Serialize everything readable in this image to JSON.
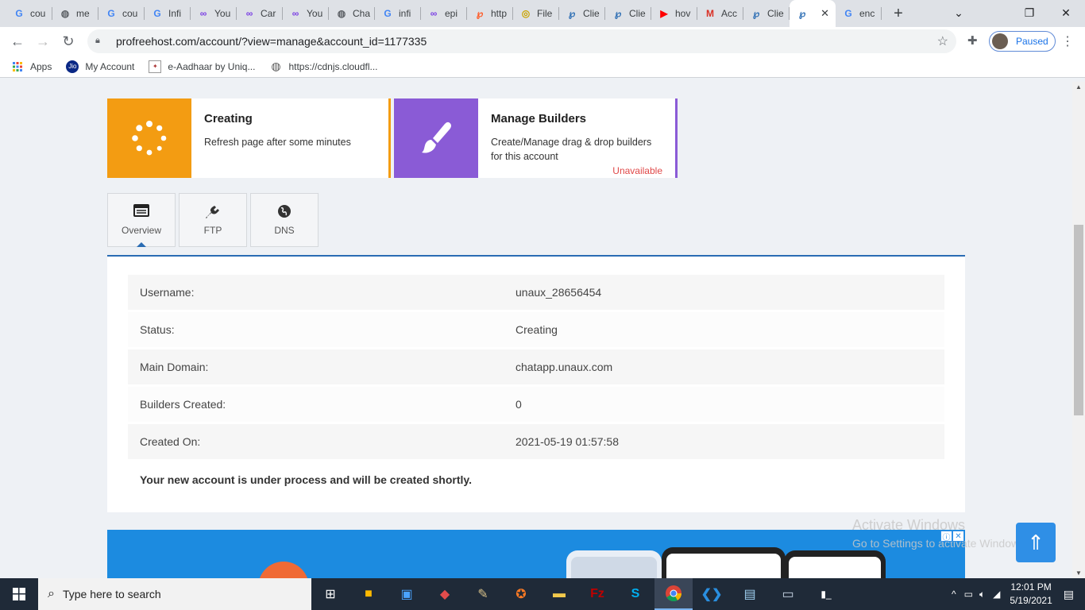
{
  "browser": {
    "tabs": [
      {
        "icon": "G",
        "title": "cou",
        "color": "#4285f4"
      },
      {
        "icon": "◍",
        "title": "me",
        "color": "#5f6368"
      },
      {
        "icon": "G",
        "title": "cou",
        "color": "#4285f4"
      },
      {
        "icon": "G",
        "title": "Infi",
        "color": "#4285f4"
      },
      {
        "icon": "∞",
        "title": "You",
        "color": "#7b3fe4"
      },
      {
        "icon": "∞",
        "title": "Car",
        "color": "#7b3fe4"
      },
      {
        "icon": "∞",
        "title": "You",
        "color": "#7b3fe4"
      },
      {
        "icon": "◍",
        "title": "Cha",
        "color": "#5f6368"
      },
      {
        "icon": "G",
        "title": "infi",
        "color": "#4285f4"
      },
      {
        "icon": "∞",
        "title": "epi",
        "color": "#7b3fe4"
      },
      {
        "icon": "℘",
        "title": "http",
        "color": "#ff5722"
      },
      {
        "icon": "◎",
        "title": "File",
        "color": "#c9a400"
      },
      {
        "icon": "℘",
        "title": "Clie",
        "color": "#2a6cb3"
      },
      {
        "icon": "℘",
        "title": "Clie",
        "color": "#2a6cb3"
      },
      {
        "icon": "▶",
        "title": "hov",
        "color": "#ff0000"
      },
      {
        "icon": "M",
        "title": "Acc",
        "color": "#d93025"
      },
      {
        "icon": "℘",
        "title": "Clie",
        "color": "#2a6cb3"
      },
      {
        "icon": "℘",
        "title": "",
        "color": "#2a6cb3",
        "active": true
      },
      {
        "icon": "G",
        "title": "enc",
        "color": "#4285f4"
      }
    ],
    "url": "profreehost.com/account/?view=manage&account_id=1177335",
    "profile_status": "Paused",
    "bookmarks": [
      {
        "label": "Apps",
        "icon": "apps-grid-icon"
      },
      {
        "label": "My Account",
        "icon": "jio-icon"
      },
      {
        "label": "e-Aadhaar by Uniq...",
        "icon": "aadhaar-icon"
      },
      {
        "label": "https://cdnjs.cloudfl...",
        "icon": "globe-icon"
      }
    ]
  },
  "cards": {
    "creating": {
      "title": "Creating",
      "desc": "Refresh page after some minutes",
      "accent": "#f39c12"
    },
    "builders": {
      "title": "Manage Builders",
      "desc": "Create/Manage drag & drop builders for this account",
      "status": "Unavailable",
      "accent": "#8a5bd6"
    }
  },
  "tabs": {
    "overview": "Overview",
    "ftp": "FTP",
    "dns": "DNS"
  },
  "details": {
    "rows": [
      {
        "key": "Username:",
        "value": "unaux_28656454"
      },
      {
        "key": "Status:",
        "value": "Creating"
      },
      {
        "key": "Main Domain:",
        "value": "chatapp.unaux.com"
      },
      {
        "key": "Builders Created:",
        "value": "0"
      },
      {
        "key": "Created On:",
        "value": "2021-05-19 01:57:58"
      }
    ],
    "note": "Your new account is under process and will be created shortly."
  },
  "watermark": {
    "line1": "Activate Windows",
    "line2": "Go to Settings to activate Windows."
  },
  "taskbar": {
    "search_placeholder": "Type here to search",
    "time": "12:01 PM",
    "date": "5/19/2021"
  }
}
